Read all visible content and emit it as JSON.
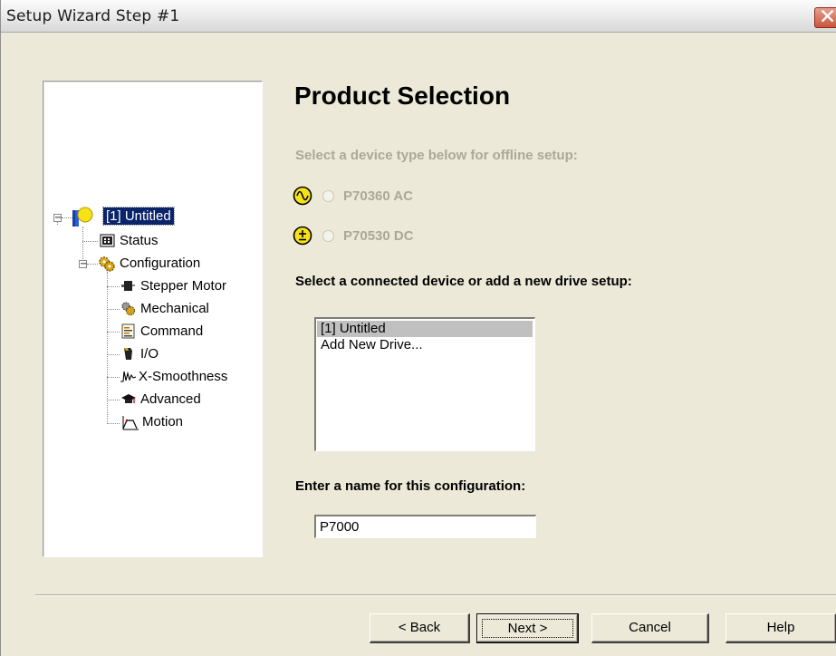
{
  "window": {
    "title": "Setup Wizard Step #1",
    "close_glyph": "✕"
  },
  "tree": {
    "root": {
      "label": "[1] Untitled",
      "icon": "device-icon"
    },
    "status": {
      "label": "Status",
      "icon": "status-icon"
    },
    "configuration": {
      "label": "Configuration",
      "icon": "gears-icon"
    },
    "children": [
      {
        "label": "Stepper Motor",
        "icon": "motor-icon"
      },
      {
        "label": "Mechanical",
        "icon": "mechanical-icon"
      },
      {
        "label": "Command",
        "icon": "command-icon"
      },
      {
        "label": "I/O",
        "icon": "io-icon"
      },
      {
        "label": "X-Smoothness",
        "icon": "smoothness-icon"
      },
      {
        "label": "Advanced",
        "icon": "graduation-cap-icon"
      },
      {
        "label": "Motion",
        "icon": "motion-icon"
      }
    ]
  },
  "main": {
    "heading": "Product Selection",
    "offline_prompt": "Select a device type below for offline setup:",
    "device_types": [
      {
        "label": "P70360 AC",
        "icon": "ac-sine-icon"
      },
      {
        "label": "P70530 DC",
        "icon": "dc-plusminus-icon"
      }
    ],
    "connected_prompt": "Select a connected device or add a new drive setup:",
    "devices": [
      "[1] Untitled",
      "Add New Drive..."
    ],
    "name_prompt": "Enter a name for this configuration:",
    "name_value": "P7000"
  },
  "buttons": {
    "back": "< Back",
    "next": "Next >",
    "cancel": "Cancel",
    "help": "Help"
  },
  "colors": {
    "disabled_text": "#aca899",
    "selection": "#0a246a",
    "window_bg": "#ece9d8",
    "close_button": "#c9553c"
  }
}
